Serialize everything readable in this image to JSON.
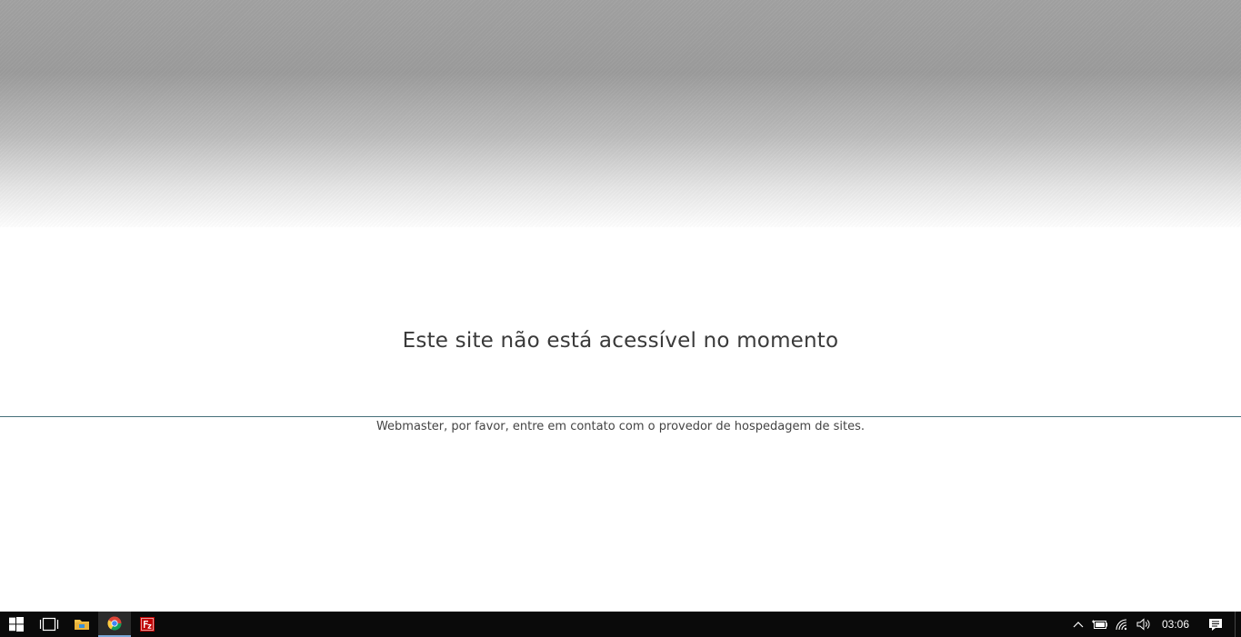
{
  "page": {
    "headline": "Este site não está acessível no momento",
    "subtext": "Webmaster, por favor, entre em contato com o provedor de hospedagem de sites."
  },
  "taskbar": {
    "apps": [
      {
        "name": "start",
        "icon": "windows-logo-icon"
      },
      {
        "name": "task-view",
        "icon": "task-view-icon"
      },
      {
        "name": "file-explorer",
        "icon": "folder-icon"
      },
      {
        "name": "chrome",
        "icon": "chrome-icon",
        "active": true
      },
      {
        "name": "filezilla",
        "icon": "filezilla-icon"
      }
    ],
    "tray": {
      "icons": [
        "chevron-up-icon",
        "battery-icon",
        "wifi-icon",
        "volume-icon"
      ],
      "clock": "03:06",
      "notification_icon": "action-center-icon"
    }
  },
  "colors": {
    "divider": "#47707a",
    "taskbar_bg": "#0a0a0a",
    "active_indicator": "#7aa7d6"
  }
}
